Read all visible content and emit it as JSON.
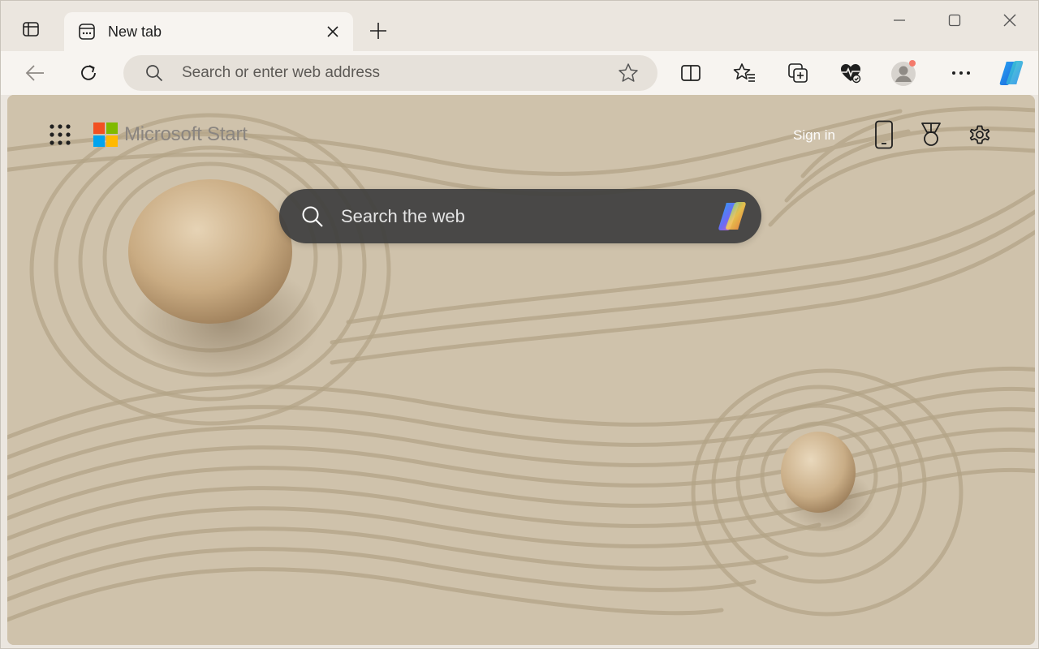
{
  "tabstrip": {
    "tab_title": "New tab",
    "icons": {
      "tab_actions": "tab-actions-icon",
      "favicon": "new-tab-page-icon",
      "close": "close-icon",
      "new_tab": "plus-icon"
    }
  },
  "window_controls": {
    "minimize": "minimize-icon",
    "maximize": "maximize-icon",
    "close": "close-icon"
  },
  "toolbar": {
    "address_placeholder": "Search or enter web address",
    "icons": [
      "back-icon",
      "refresh-icon",
      "search-icon",
      "favorite-star-icon",
      "split-screen-icon",
      "favorites-icon",
      "collections-icon",
      "browser-essentials-icon",
      "profile-icon",
      "more-icon",
      "copilot-icon"
    ]
  },
  "newtab": {
    "brand": "Microsoft Start",
    "signin_label": "Sign in",
    "search_placeholder": "Search the web",
    "icons": [
      "apps-grid-icon",
      "phone-icon",
      "rewards-icon",
      "settings-icon",
      "search-icon",
      "copilot-icon"
    ]
  },
  "colors": {
    "ms_red": "#f25022",
    "ms_green": "#7fba00",
    "ms_blue": "#00a4ef",
    "ms_yellow": "#ffb900",
    "sand": "#cdbfa8",
    "searchbox": "#3e3e3e"
  }
}
